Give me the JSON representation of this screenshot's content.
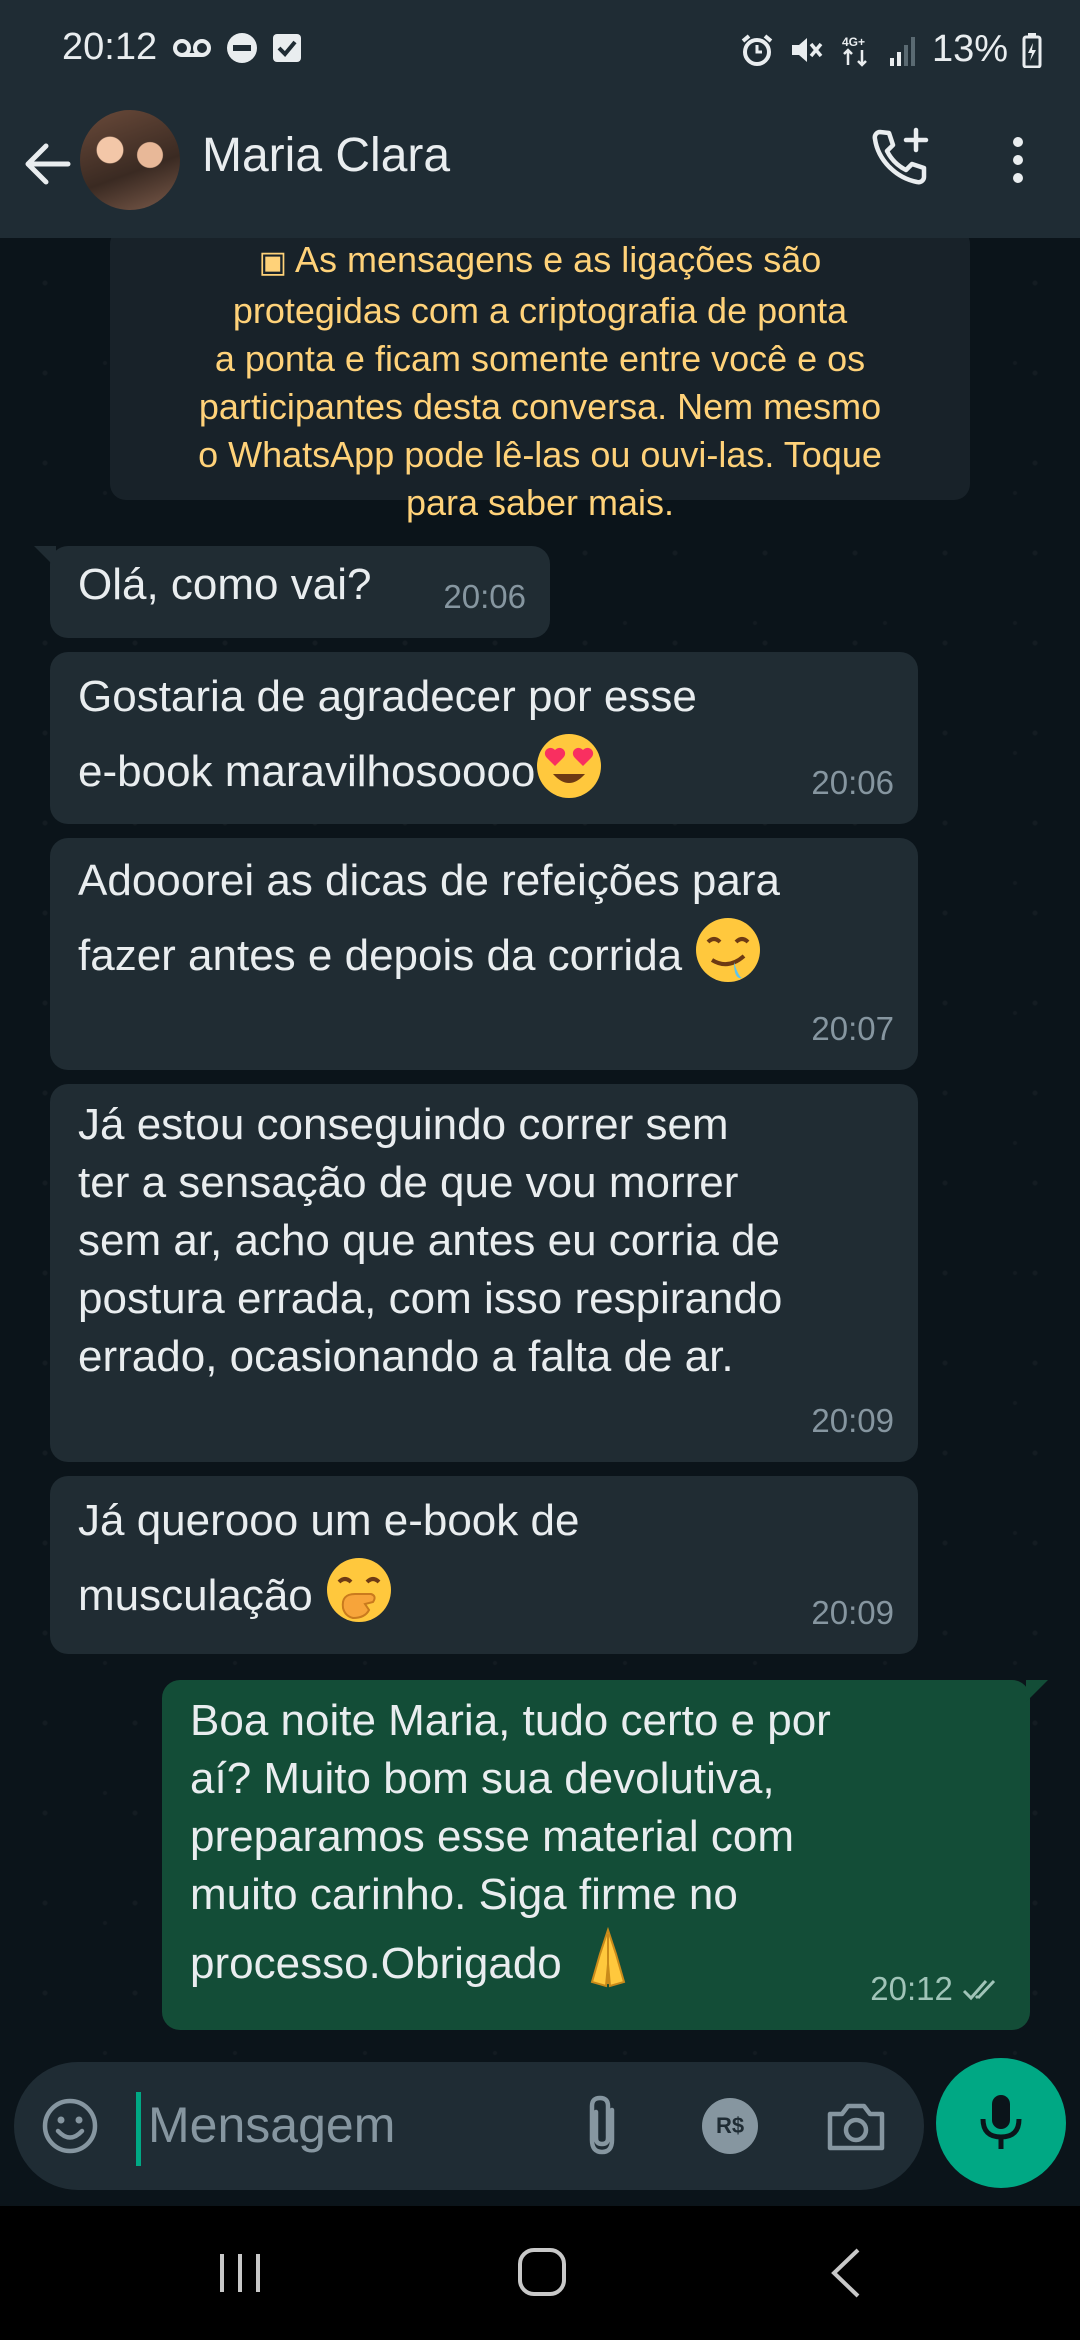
{
  "status_bar": {
    "time": "20:12",
    "battery": "13%",
    "network": "4G+"
  },
  "header": {
    "contact_name": "Maria Clara"
  },
  "encryption_notice": {
    "lines": [
      "As mensagens e as ligações são",
      "protegidas com a criptografia de ponta",
      "a ponta e ficam somente entre você e os",
      "participantes desta conversa. Nem mesmo",
      "o WhatsApp pode lê-las ou ouvi-las. Toque",
      "para saber mais."
    ]
  },
  "messages": [
    {
      "direction": "in",
      "text": "Olá, como vai?",
      "time": "20:06"
    },
    {
      "direction": "in",
      "text": "Gostaria de agradecer por esse\ne-book maravilhosoooo",
      "emoji": "heart-eyes",
      "time": "20:06"
    },
    {
      "direction": "in",
      "text": "Adooorei as dicas de refeições para\nfazer antes e depois da corrida",
      "emoji": "drooling",
      "time": "20:07"
    },
    {
      "direction": "in",
      "text": "Já estou conseguindo correr sem\nter a sensação de que vou morrer\nsem ar, acho que antes eu corria de\npostura errada, com isso respirando\nerrado, ocasionando a falta de ar.",
      "time": "20:09"
    },
    {
      "direction": "in",
      "text": "Já querooo um e-book de\nmusculação",
      "emoji": "hand-over-mouth",
      "time": "20:09"
    },
    {
      "direction": "out",
      "text": "Boa noite Maria, tudo certo e por\naí? Muito bom sua devolutiva,\npreparamos esse material com\nmuito carinho. Siga firme no\nprocesso.Obrigado",
      "emoji": "folded-hands",
      "time": "20:12",
      "status": "read"
    }
  ],
  "input": {
    "placeholder": "Mensagem",
    "payment_label": "R$"
  },
  "colors": {
    "accent": "#00a884",
    "incoming": "#202c33",
    "outgoing": "#134d37",
    "notice_text": "#ffd279"
  },
  "icons": [
    "back-arrow-icon",
    "add-call-icon",
    "more-options-icon",
    "emoji-icon",
    "attach-icon",
    "payment-icon",
    "camera-icon",
    "mic-icon"
  ]
}
